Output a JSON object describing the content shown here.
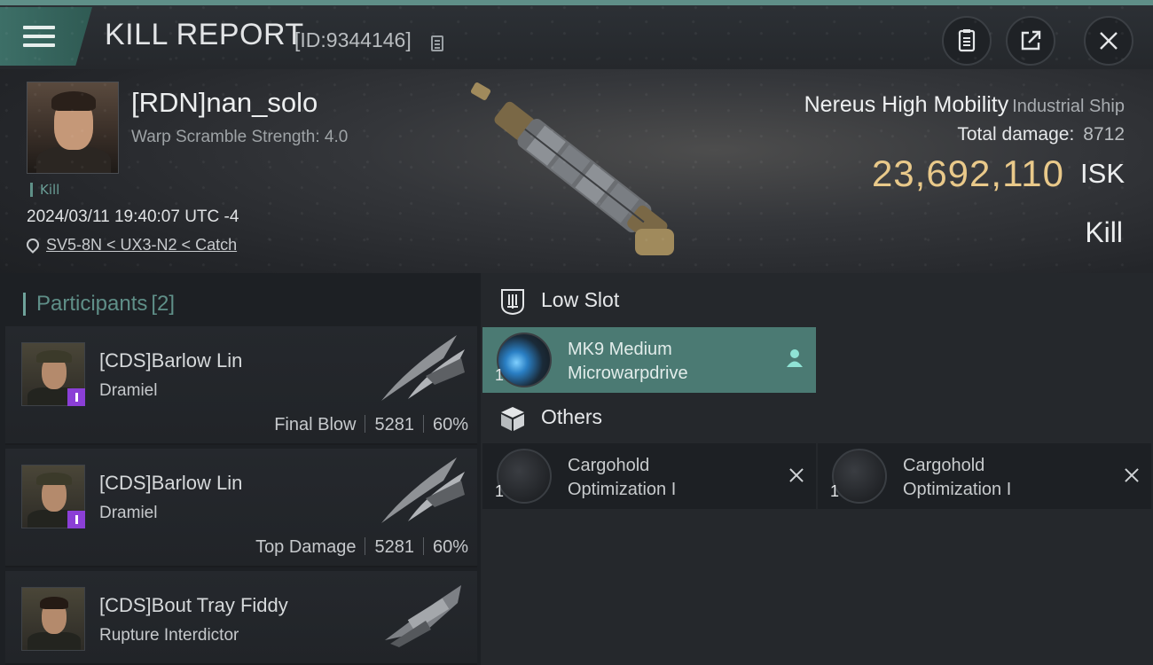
{
  "header": {
    "title": "KILL REPORT",
    "report_id": "[ID:9344146]",
    "icons": [
      "menu-icon",
      "copy-icon",
      "clipboard-icon",
      "share-icon",
      "close-icon"
    ]
  },
  "victim": {
    "name": "[RDN]nan_solo",
    "subtitle": "Warp Scramble Strength: 4.0",
    "kill_label": "Kill",
    "datetime": "2024/03/11 19:40:07 UTC -4",
    "location": "SV5-8N < UX3-N2 < Catch"
  },
  "ship": {
    "name": "Nereus High Mobility",
    "class": "Industrial Ship",
    "total_damage_label": "Total damage:",
    "total_damage": "8712",
    "isk_value": "23,692,110",
    "isk_unit": "ISK",
    "result": "Kill"
  },
  "participants": {
    "title": "Participants",
    "count": "[2]",
    "items": [
      {
        "name": "[CDS]Barlow Lin",
        "ship": "Dramiel",
        "role": "Final Blow",
        "damage": "5281",
        "percent": "60%"
      },
      {
        "name": "[CDS]Barlow Lin",
        "ship": "Dramiel",
        "role": "Top Damage",
        "damage": "5281",
        "percent": "60%"
      },
      {
        "name": "[CDS]Bout Tray Fiddy",
        "ship": "Rupture Interdictor"
      }
    ]
  },
  "fitting": {
    "low_slot": {
      "title": "Low Slot",
      "items": [
        {
          "qty": "1",
          "name_line1": "MK9 Medium",
          "name_line2": "Microwarpdrive"
        }
      ]
    },
    "others": {
      "title": "Others",
      "items": [
        {
          "qty": "1",
          "name_line1": "Cargohold",
          "name_line2": "Optimization I"
        },
        {
          "qty": "1",
          "name_line1": "Cargohold",
          "name_line2": "Optimization I"
        }
      ]
    }
  },
  "colors": {
    "accent_teal": "#5f8f88",
    "isk_gold": "#e9c98a",
    "badge_purple": "#8b3fd6"
  }
}
